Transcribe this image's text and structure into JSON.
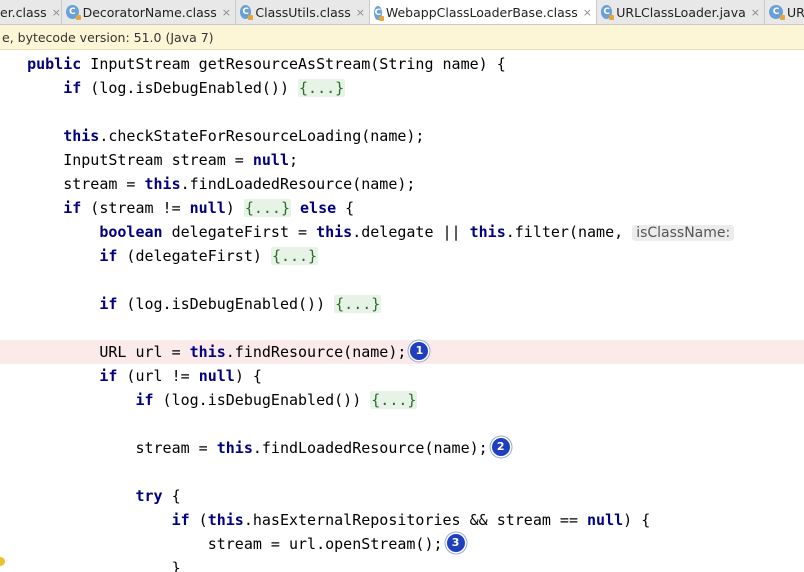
{
  "tabs": [
    {
      "label": "er.class",
      "icon": "class-icon",
      "active": false,
      "icon_shown": false
    },
    {
      "label": "DecoratorName.class",
      "icon": "class-icon",
      "active": false,
      "icon_shown": true
    },
    {
      "label": "ClassUtils.class",
      "icon": "class-icon",
      "active": false,
      "icon_shown": true
    },
    {
      "label": "WebappClassLoaderBase.class",
      "icon": "class-icon",
      "active": true,
      "icon_shown": true
    },
    {
      "label": "URLClassLoader.java",
      "icon": "class-icon",
      "active": false,
      "icon_shown": true
    },
    {
      "label": "UR",
      "icon": "class-icon",
      "active": false,
      "icon_shown": true
    }
  ],
  "tab_close_glyph": "×",
  "info_bar": {
    "text": "e, bytecode version: 51.0 (Java 7)"
  },
  "code": {
    "l01": {
      "kw1": "public",
      "t1": " InputStream getResourceAsStream(String name) {"
    },
    "l02": {
      "kw1": "if",
      "t1": " (log.isDebugEnabled()) ",
      "fold1": "{...}"
    },
    "l04": {
      "kw1": "this",
      "t1": ".checkStateForResourceLoading(name);"
    },
    "l05": {
      "t1": "InputStream stream = ",
      "kw1": "null",
      "t2": ";"
    },
    "l06": {
      "t1": "stream = ",
      "kw1": "this",
      "t2": ".findLoadedResource(name);"
    },
    "l07": {
      "kw1": "if",
      "t1": " (stream != ",
      "kw2": "null",
      "t2": ") ",
      "fold1": "{...}",
      "t3": " ",
      "kw3": "else",
      "t4": " {"
    },
    "l08": {
      "kw1": "boolean",
      "t1": " delegateFirst = ",
      "kw2": "this",
      "t2": ".delegate || ",
      "kw3": "this",
      "t3": ".filter(name, ",
      "hint": "isClassName:"
    },
    "l09": {
      "kw1": "if",
      "t1": " (delegateFirst) ",
      "fold1": "{...}"
    },
    "l11": {
      "kw1": "if",
      "t1": " (log.isDebugEnabled()) ",
      "fold1": "{...}"
    },
    "l13": {
      "t1": "URL url = ",
      "kw1": "this",
      "t2": ".findResource(name);",
      "badge": "1"
    },
    "l14": {
      "kw1": "if",
      "t1": " (url != ",
      "kw2": "null",
      "t2": ") {"
    },
    "l15": {
      "kw1": "if",
      "t1": " (log.isDebugEnabled()) ",
      "fold1": "{...}"
    },
    "l17": {
      "t1": "stream = ",
      "kw1": "this",
      "t2": ".findLoadedResource(name);",
      "badge": "2"
    },
    "l19": {
      "kw1": "try",
      "t1": " {"
    },
    "l20": {
      "kw1": "if",
      "t1": " (",
      "kw2": "this",
      "t2": ".hasExternalRepositories && stream == ",
      "kw3": "null",
      "t3": ") {"
    },
    "l21": {
      "t1": "stream = url.openStream();",
      "badge": "3"
    },
    "l22": {
      "t1": "}"
    }
  },
  "colors": {
    "keyword": "#000080",
    "fold_bg": "#e6f3e6",
    "highlight_line": "#faeaea",
    "info_bar_bg": "#fdf6d6",
    "badge": "#1f3fbf"
  }
}
